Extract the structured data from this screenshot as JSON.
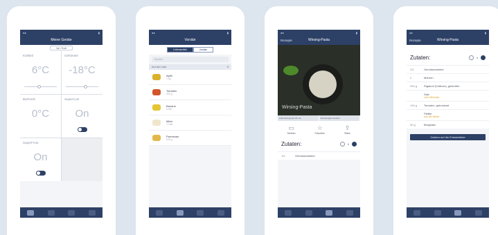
{
  "phone1": {
    "nav_title": "Meine Geräte",
    "segment": "Ist / Soll",
    "cells": [
      {
        "label": "Kühlteil",
        "value": "6°C"
      },
      {
        "label": "Gefrierteil",
        "value": "-18°C"
      },
      {
        "label": "BioFresh",
        "value": "0°C"
      },
      {
        "label": "SuperCool",
        "value": "On"
      },
      {
        "label": "SuperFrost",
        "value": "On"
      }
    ]
  },
  "phone2": {
    "nav_title": "Vorräte",
    "tabs": [
      "Lebensmittel",
      "Vorräte"
    ],
    "search_placeholder": "Suchen",
    "section": {
      "title": "Auf der Liste",
      "count": "5"
    },
    "items": [
      {
        "name": "Apfel",
        "sub": "1 kg",
        "color": "#d9b12b"
      },
      {
        "name": "Tomaten",
        "sub": "500 g",
        "color": "#d2562b"
      },
      {
        "name": "Banane",
        "sub": "6 Stk",
        "color": "#e5c534"
      },
      {
        "name": "Milch",
        "sub": "1 Liter",
        "color": "#efe6cc"
      },
      {
        "name": "Parmesan",
        "sub": "200 g",
        "color": "#e3b84a"
      }
    ]
  },
  "phone3": {
    "back_label": "Rezepte",
    "nav_title": "Wirsing-Pasta",
    "caption": "Wirsing-Pasta",
    "info": [
      "Zubereitungszeit 30 min",
      "Schwierigkeit einfach"
    ],
    "actions": [
      {
        "label": "Merken",
        "icon": "monitor-icon"
      },
      {
        "label": "Favoriten",
        "icon": "star-icon"
      },
      {
        "label": "Teilen",
        "icon": "share-icon"
      }
    ],
    "zutaten": "Zutaten:",
    "servings": "4",
    "ingredients": [
      {
        "qty": "1/2",
        "name": "Gemüsezwiebel"
      }
    ]
  },
  "phone4": {
    "back_label": "Rezepte",
    "nav_title": "Wirsing-Pasta",
    "zutaten": "Zutaten:",
    "servings": "4",
    "ingredients": [
      {
        "qty": "1/2",
        "name": "Gemüsezwiebel",
        "alt": ""
      },
      {
        "qty": "2",
        "name": "Möhren",
        "alt": ""
      },
      {
        "qty": "250 g",
        "name": "Rigatoni (Vollkorn), glutenfrei",
        "alt": ""
      },
      {
        "qty": "",
        "name": "Salz",
        "alt": "oder Meersalz"
      },
      {
        "qty": "100 g",
        "name": "Tomaten, getrocknet",
        "alt": ""
      },
      {
        "qty": "",
        "name": "Pfeffer",
        "alt": "aus der Mühle"
      },
      {
        "qty": "50 g",
        "name": "Bergkäse",
        "alt": ""
      }
    ],
    "button": "Zutaten auf die Einkaufsliste"
  }
}
